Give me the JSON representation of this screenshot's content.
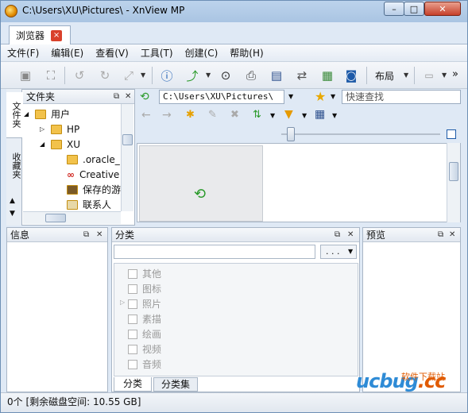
{
  "window": {
    "title": "C:\\Users\\XU\\Pictures\\ - XnView MP",
    "min_glyph": "–",
    "max_glyph": "□",
    "close_glyph": "✕"
  },
  "tab": {
    "label": "浏览器",
    "close_glyph": "×"
  },
  "menu": [
    "文件(F)",
    "编辑(E)",
    "查看(V)",
    "工具(T)",
    "创建(C)",
    "帮助(H)"
  ],
  "toolbar": {
    "layout_label": "布局",
    "more": "»"
  },
  "left_tabs": [
    "文件夹",
    "收藏夹"
  ],
  "folders_panel": {
    "title": "文件夹",
    "items": [
      {
        "label": "用户",
        "expander": "◢"
      },
      {
        "label": "HP",
        "expander": "▷"
      },
      {
        "label": "XU",
        "expander": "◢"
      },
      {
        "label": ".oracle_",
        "expander": ""
      },
      {
        "label": "Creative",
        "expander": ""
      },
      {
        "label": "保存的游",
        "expander": ""
      },
      {
        "label": "联系人",
        "expander": ""
      }
    ]
  },
  "address": {
    "path": "C:\\Users\\XU\\Pictures\\",
    "quick_search_placeholder": "快速查找"
  },
  "panels": {
    "info": {
      "title": "信息"
    },
    "category": {
      "title": "分类",
      "dropdown": ". . .",
      "items": [
        "其他",
        "图标",
        "照片",
        "素描",
        "绘画",
        "视频",
        "音频"
      ],
      "tabs": [
        "分类",
        "分类集"
      ]
    },
    "preview": {
      "title": "预览"
    }
  },
  "status": {
    "text": "0个 [剩余磁盘空间: 10.55 GB]"
  },
  "watermark": {
    "brand": "ucbug",
    "suffix": ".cc",
    "sub": "软件下载站"
  },
  "colors": {
    "accent": "#6d8fb5",
    "folder": "#f2c24b"
  }
}
